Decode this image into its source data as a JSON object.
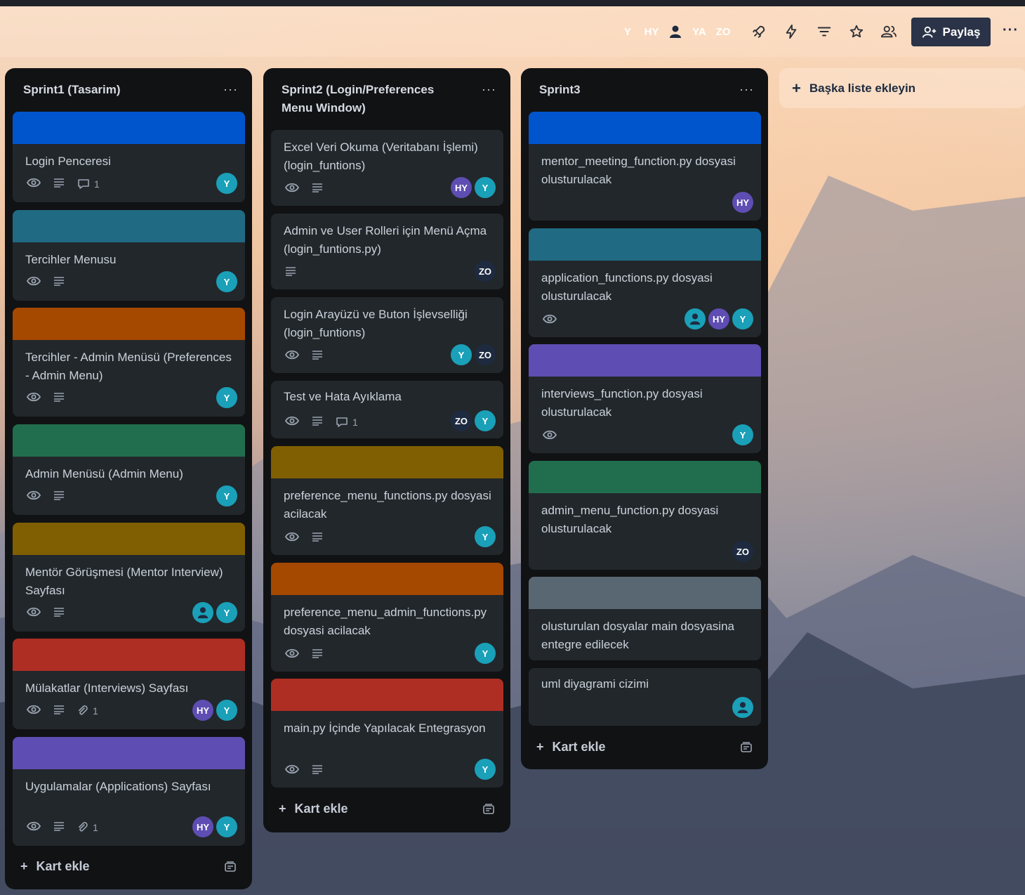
{
  "header": {
    "members": [
      {
        "initials": "Y",
        "color": "#1aa0b8"
      },
      {
        "initials": "HY",
        "color": "#5e4db2"
      },
      {
        "initials": "",
        "color": "#1aa0b8",
        "icon": "person-icon"
      },
      {
        "initials": "YA",
        "color": "#1e2a40"
      },
      {
        "initials": "ZO",
        "color": "#1e2a40"
      }
    ],
    "tools": [
      "power-ups-icon",
      "automation-icon",
      "filter-icon",
      "star-icon",
      "visibility-icon"
    ],
    "share_label": "Paylaş",
    "more_label": "···"
  },
  "lists": [
    {
      "title": "Sprint1 (Tasarim)",
      "add_label": "Kart ekle",
      "cards": [
        {
          "cover": "#0055cc",
          "title": "Login Penceresi",
          "watch": true,
          "desc": true,
          "comments": "1",
          "members": [
            "Y"
          ]
        },
        {
          "cover": "#206a83",
          "title": "Tercihler Menusu",
          "watch": true,
          "desc": true,
          "members": [
            "Y"
          ]
        },
        {
          "cover": "#a54800",
          "title": "Tercihler - Admin Menüsü (Preferences - Admin Menu)",
          "watch": true,
          "desc": true,
          "members": [
            "Y"
          ]
        },
        {
          "cover": "#216e4e",
          "title": "Admin Menüsü (Admin Menu)",
          "watch": true,
          "desc": true,
          "members": [
            "Y"
          ]
        },
        {
          "cover": "#7f5f01",
          "title": "Mentör Görüşmesi (Mentor Interview) Sayfası",
          "watch": true,
          "desc": true,
          "members": [
            "P",
            "Y"
          ]
        },
        {
          "cover": "#ae2e24",
          "title": "Mülakatlar (Interviews) Sayfası",
          "watch": true,
          "desc": true,
          "attachments": "1",
          "members": [
            "HY",
            "Y"
          ]
        },
        {
          "cover": "#5e4db2",
          "title": "Uygulamalar (Applications) Sayfası",
          "watch": true,
          "desc": true,
          "attachments": "1",
          "members": [
            "HY",
            "Y"
          ]
        }
      ]
    },
    {
      "title": "Sprint2 (Login/Preferences Menu Window)",
      "add_label": "Kart ekle",
      "cards": [
        {
          "title": "Excel Veri Okuma (Veritabanı İşlemi) (login_funtions)",
          "watch": true,
          "desc": true,
          "members": [
            "HY",
            "Y"
          ]
        },
        {
          "title": "Admin ve User Rolleri için Menü Açma (login_funtions.py)",
          "desc": true,
          "members": [
            "ZO"
          ]
        },
        {
          "title": "Login Arayüzü ve Buton İşlevselliği (login_funtions)",
          "watch": true,
          "desc": true,
          "members": [
            "Y",
            "ZO"
          ]
        },
        {
          "title": "Test ve Hata Ayıklama",
          "watch": true,
          "desc": true,
          "comments": "1",
          "members": [
            "ZO",
            "Y"
          ]
        },
        {
          "cover": "#7f5f01",
          "title": "preference_menu_functions.py dosyasi acilacak",
          "watch": true,
          "desc": true,
          "members": [
            "Y"
          ]
        },
        {
          "cover": "#a54800",
          "title": "preference_menu_admin_functions.py dosyasi acilacak",
          "watch": true,
          "desc": true,
          "members": [
            "Y"
          ]
        },
        {
          "cover": "#ae2e24",
          "title": "main.py İçinde Yapılacak Entegrasyon",
          "watch": true,
          "desc": true,
          "members": [
            "Y"
          ]
        }
      ]
    },
    {
      "title": "Sprint3",
      "add_label": "Kart ekle",
      "cards": [
        {
          "cover": "#0055cc",
          "title": "mentor_meeting_function.py dosyasi olusturulacak",
          "members": [
            "HY"
          ]
        },
        {
          "cover": "#206a83",
          "title": "application_functions.py dosyasi olusturulacak",
          "watch": true,
          "members": [
            "P",
            "HY",
            "Y"
          ]
        },
        {
          "cover": "#5e4db2",
          "title": "interviews_function.py dosyasi olusturulacak",
          "watch": true,
          "members": [
            "Y"
          ]
        },
        {
          "cover": "#216e4e",
          "title": "admin_menu_function.py dosyasi olusturulacak",
          "members": [
            "ZO"
          ]
        },
        {
          "cover": "#596773",
          "title": "olusturulan dosyalar main dosyasina entegre edilecek",
          "members": []
        },
        {
          "title": "uml diyagrami cizimi",
          "members": [
            "P"
          ]
        }
      ]
    }
  ],
  "add_list_label": "Başka liste ekleyin"
}
